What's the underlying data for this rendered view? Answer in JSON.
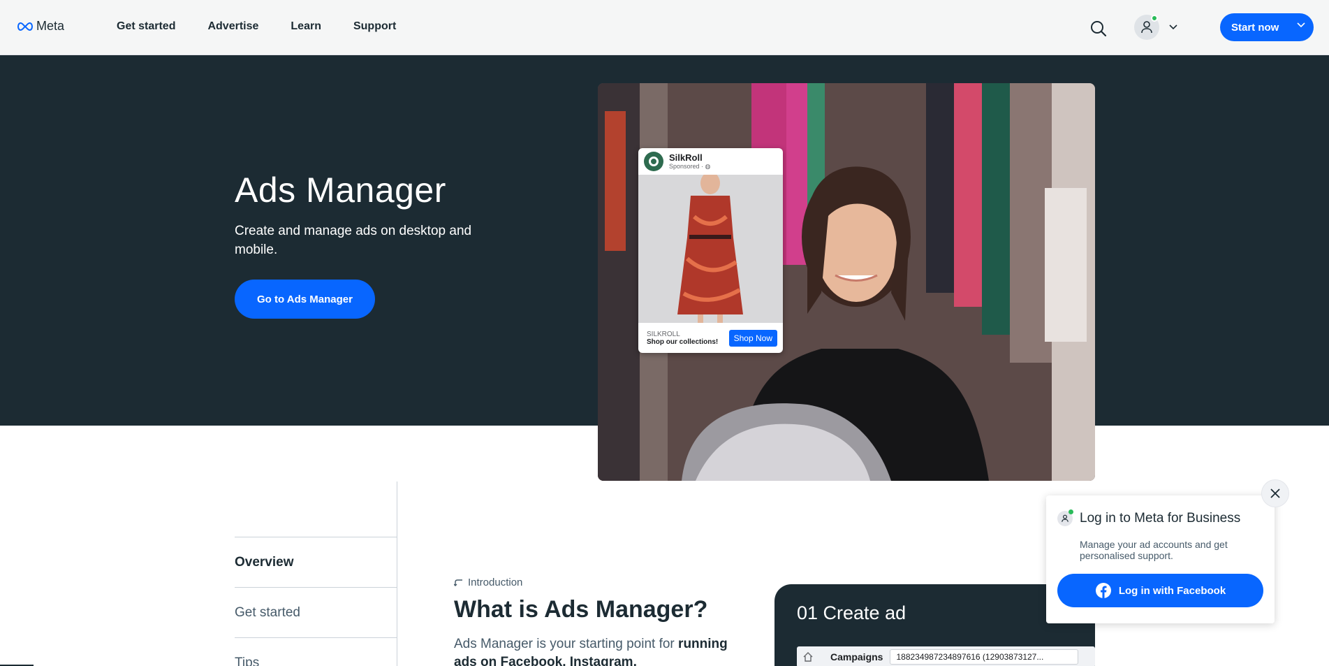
{
  "header": {
    "logo_text": "Meta",
    "nav": [
      "Get started",
      "Advertise",
      "Learn",
      "Support"
    ],
    "start_label": "Start now"
  },
  "hero": {
    "title": "Ads Manager",
    "subtitle": "Create and manage ads on desktop and mobile.",
    "cta": "Go to Ads Manager"
  },
  "ad_card": {
    "brand": "SilkRoll",
    "sponsored": "Sponsored · ",
    "brand_caps": "SILKROLL",
    "tagline": "Shop our collections!",
    "shop_label": "Shop Now"
  },
  "sidebar": {
    "items": [
      "Overview",
      "Get started",
      "Tips"
    ]
  },
  "intro": {
    "eyebrow": "Introduction",
    "title": "What is Ads Manager?",
    "text_plain": "Ads Manager is your starting point for ",
    "text_bold": "running ads on Facebook, Instagram,"
  },
  "create_card": {
    "title": "01 Create ad",
    "bar_label": "Campaigns",
    "bar_value": "188234987234897616 (12903873127..."
  },
  "popup": {
    "title": "Log in to Meta for Business",
    "text": "Manage your ad accounts and get personalised support.",
    "button": "Log in with Facebook"
  },
  "colors": {
    "accent": "#0866ff",
    "hero_bg": "#1c2b33",
    "status_green": "#2abb5a"
  }
}
